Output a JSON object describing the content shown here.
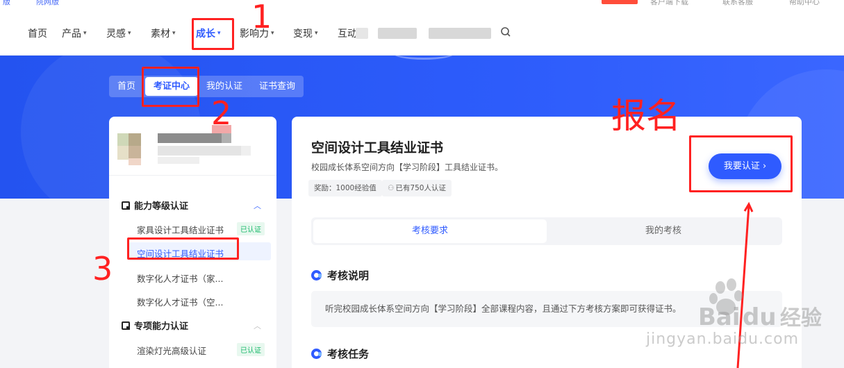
{
  "nav": {
    "items": [
      {
        "label": "首页",
        "caret": false
      },
      {
        "label": "产品",
        "caret": true
      },
      {
        "label": "灵感",
        "caret": true
      },
      {
        "label": "素材",
        "caret": true
      },
      {
        "label": "成长",
        "caret": true,
        "active": true
      },
      {
        "label": "影响力",
        "caret": true
      },
      {
        "label": "变现",
        "caret": true
      },
      {
        "label": "互动",
        "caret": false
      }
    ]
  },
  "subnav": {
    "tabs": [
      "首页",
      "考证中心",
      "我的认证",
      "证书查询"
    ]
  },
  "sidebar": {
    "sections": [
      {
        "title": "能力等级认证",
        "items": [
          {
            "label": "家具设计工具结业证书",
            "badge": "已认证"
          },
          {
            "label": "空间设计工具结业证书",
            "active": true
          },
          {
            "label": "数字化人才证书（家..."
          },
          {
            "label": "数字化人才证书（空..."
          }
        ]
      },
      {
        "title": "专项能力认证",
        "items": [
          {
            "label": "渲染灯光高级认证",
            "badge": "已认证"
          }
        ]
      }
    ]
  },
  "cert": {
    "title": "空间设计工具结业证书",
    "subtitle": "校园成长体系空间方向【学习阶段】工具结业证书。",
    "reward": "奖励：1000经验值",
    "certified_count": "已有750人认证",
    "cta": "我要认证 ›"
  },
  "tabs": [
    "考核要求",
    "我的考核"
  ],
  "sections": {
    "desc_title": "考核说明",
    "desc_text": "听完校园成长体系空间方向【学习阶段】全部课程内容，且通过下方考核方案即可获得证书。",
    "task_title": "考核任务"
  },
  "annotations": {
    "n1": "1",
    "n2": "2",
    "n3": "3",
    "signup": "报名"
  },
  "watermark": {
    "url": "jingyan.baidu.com"
  },
  "colors": {
    "brand_blue": "#2f5bff",
    "annotation_red": "#ff2121",
    "certified_green": "#19b86a"
  }
}
